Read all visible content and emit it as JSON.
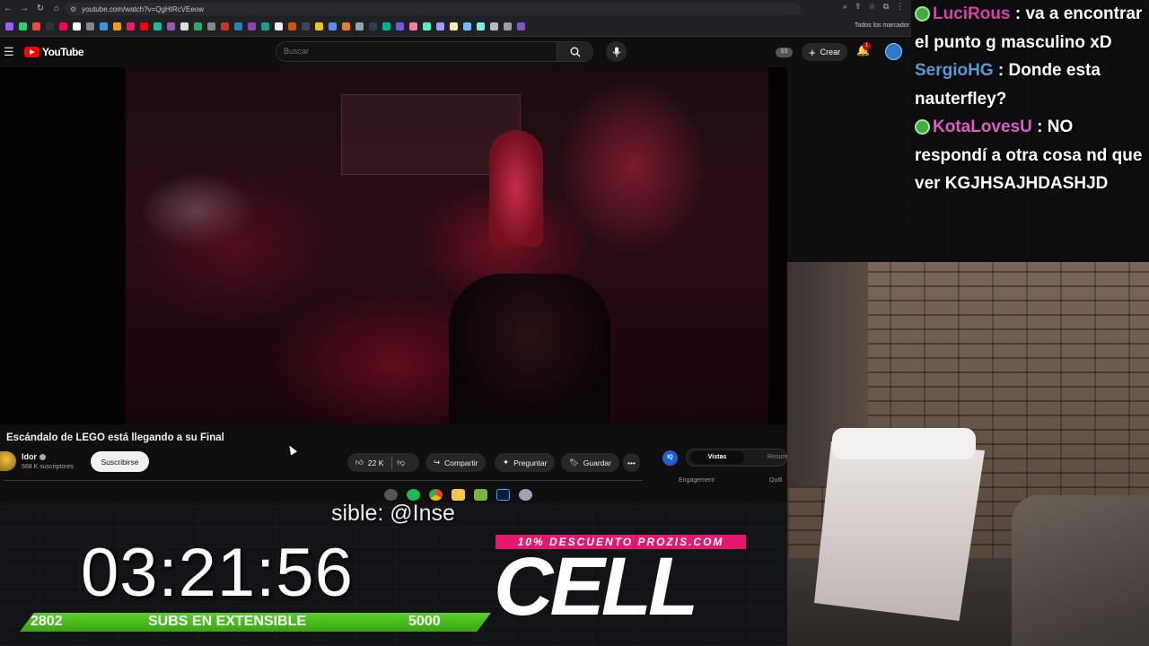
{
  "browser": {
    "url": "youtube.com/watch?v=QgHtRcVEeow",
    "bookmarks_all_label": "Todos los marcador"
  },
  "youtube": {
    "logo": "YouTube",
    "search_placeholder": "Buscar",
    "ss_badge": "SS",
    "create_label": "Crear",
    "notification_count": "1"
  },
  "video": {
    "title": "Escándalo de LEGO está llegando a su Final",
    "channel_name": "Idor",
    "subscribers": "568 K suscriptores",
    "subscribe_label": "Suscribirse",
    "likes": "22 K",
    "share_label": "Compartir",
    "ask_label": "Preguntar",
    "save_label": "Guardar",
    "more_label": "•••"
  },
  "side_panel": {
    "badge": "IQ",
    "tab_views": "Vistas",
    "tab_summary": "Resum",
    "engagement": "Engagement",
    "outline": "Outli"
  },
  "chat": [
    {
      "user": "LuciRous",
      "text": " : va a encontrar el punto g masculino xD",
      "badge": true,
      "color": "#d93fb0"
    },
    {
      "user": "SergioHG",
      "text": " : Donde esta nauterfley?",
      "badge": false,
      "color": "#4f9ed8"
    },
    {
      "user": "KotaLovesU",
      "text": " : NO respondí a otra cosa nd que ver KGJHSAJHDASHJD",
      "badge": true,
      "color": "#e05cc7"
    }
  ],
  "stream_overlay": {
    "marquee": "sible: @Inse",
    "timer": "03:21:56",
    "subs_current": "2802",
    "subs_label": "SUBS EN EXTENSIBLE",
    "subs_goal": "5000",
    "promo": "10% DESCUENTO PROZIS.COM",
    "brand": "CELL"
  },
  "colors": {
    "youtube_red": "#ff0000",
    "promo_pink": "#e5186d",
    "subs_green": "#4cc21f"
  }
}
